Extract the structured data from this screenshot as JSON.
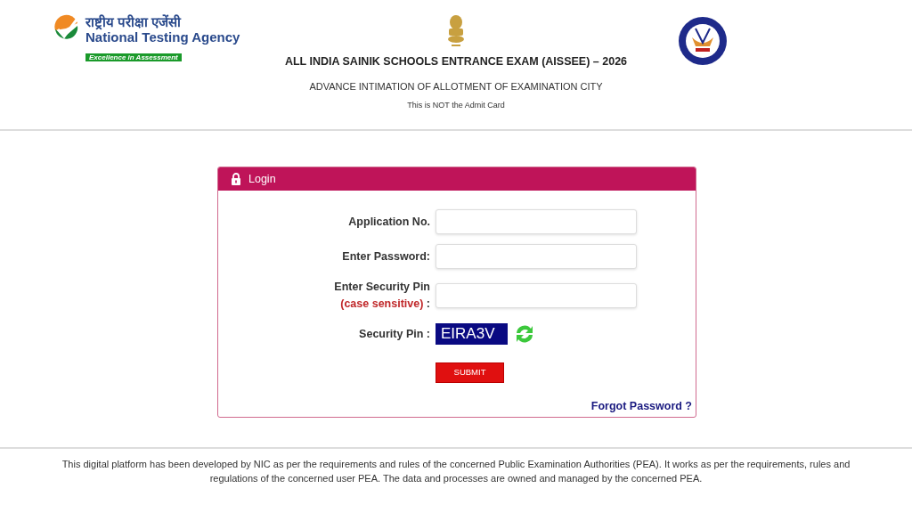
{
  "header": {
    "agency_hindi": "राष्ट्रीय परीक्षा एजेंसी",
    "agency_name": "National Testing Agency",
    "tagline": "Excellence in Assessment",
    "title": "ALL INDIA SAINIK SCHOOLS ENTRANCE EXAM (AISSEE) – 2026",
    "subtitle": "ADVANCE INTIMATION OF ALLOTMENT OF EXAMINATION CITY",
    "note": "This is NOT the Admit Card"
  },
  "login": {
    "title": "Login",
    "fields": [
      {
        "kind": "input",
        "label": "Application No."
      },
      {
        "kind": "input",
        "label": "Enter Password:"
      },
      {
        "kind": "input",
        "label": "Enter Security Pin",
        "sublabel": "(case sensitive)",
        "suffix": ":"
      },
      {
        "kind": "captcha",
        "label": "Security Pin :",
        "value": "EIRA3V"
      }
    ],
    "submit": "SUBMIT",
    "forgot": "Forgot Password ?"
  },
  "footer": "This digital platform has been developed by NIC as per the requirements and rules of the concerned Public Examination Authorities (PEA). It works as per the requirements, rules and regulations of the concerned user PEA. The data and processes are owned and managed by the concerned PEA."
}
